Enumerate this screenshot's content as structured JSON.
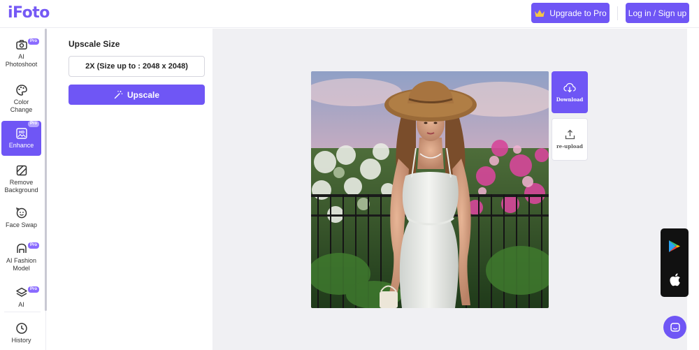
{
  "header": {
    "logo": "iFoto",
    "upgrade_label": "Upgrade to Pro",
    "login_label": "Log in / Sign up"
  },
  "sidebar": {
    "pro_badge": "Pro",
    "items": [
      {
        "label_line1": "AI",
        "label_line2": "Photoshoot",
        "pro": true
      },
      {
        "label_line1": "Color",
        "label_line2": "Change",
        "pro": false
      },
      {
        "label_line1": "Enhance",
        "label_line2": "",
        "pro": true,
        "active": true
      },
      {
        "label_line1": "Remove",
        "label_line2": "Background",
        "pro": false
      },
      {
        "label_line1": "Face Swap",
        "label_line2": "",
        "pro": false
      },
      {
        "label_line1": "AI Fashion",
        "label_line2": "Model",
        "pro": true
      },
      {
        "label_line1": "AI",
        "label_line2": "",
        "pro": true
      },
      {
        "label_line1": "History",
        "label_line2": "",
        "pro": false
      }
    ]
  },
  "panel": {
    "title": "Upscale Size",
    "size_option": "2X (Size up to : 2048 x 2048)",
    "upscale_label": "Upscale"
  },
  "actions": {
    "download_label": "Download",
    "reupload_label": "re-upload"
  },
  "colors": {
    "accent": "#6f56f5",
    "canvas_bg": "#f0f0f3"
  },
  "icons": {
    "upgrade": "crown-icon",
    "upscale": "magic-wand-icon",
    "download": "cloud-download-icon",
    "reupload": "upload-icon",
    "store1": "google-play-icon",
    "store2": "apple-icon",
    "chat": "chat-bubble-icon"
  }
}
